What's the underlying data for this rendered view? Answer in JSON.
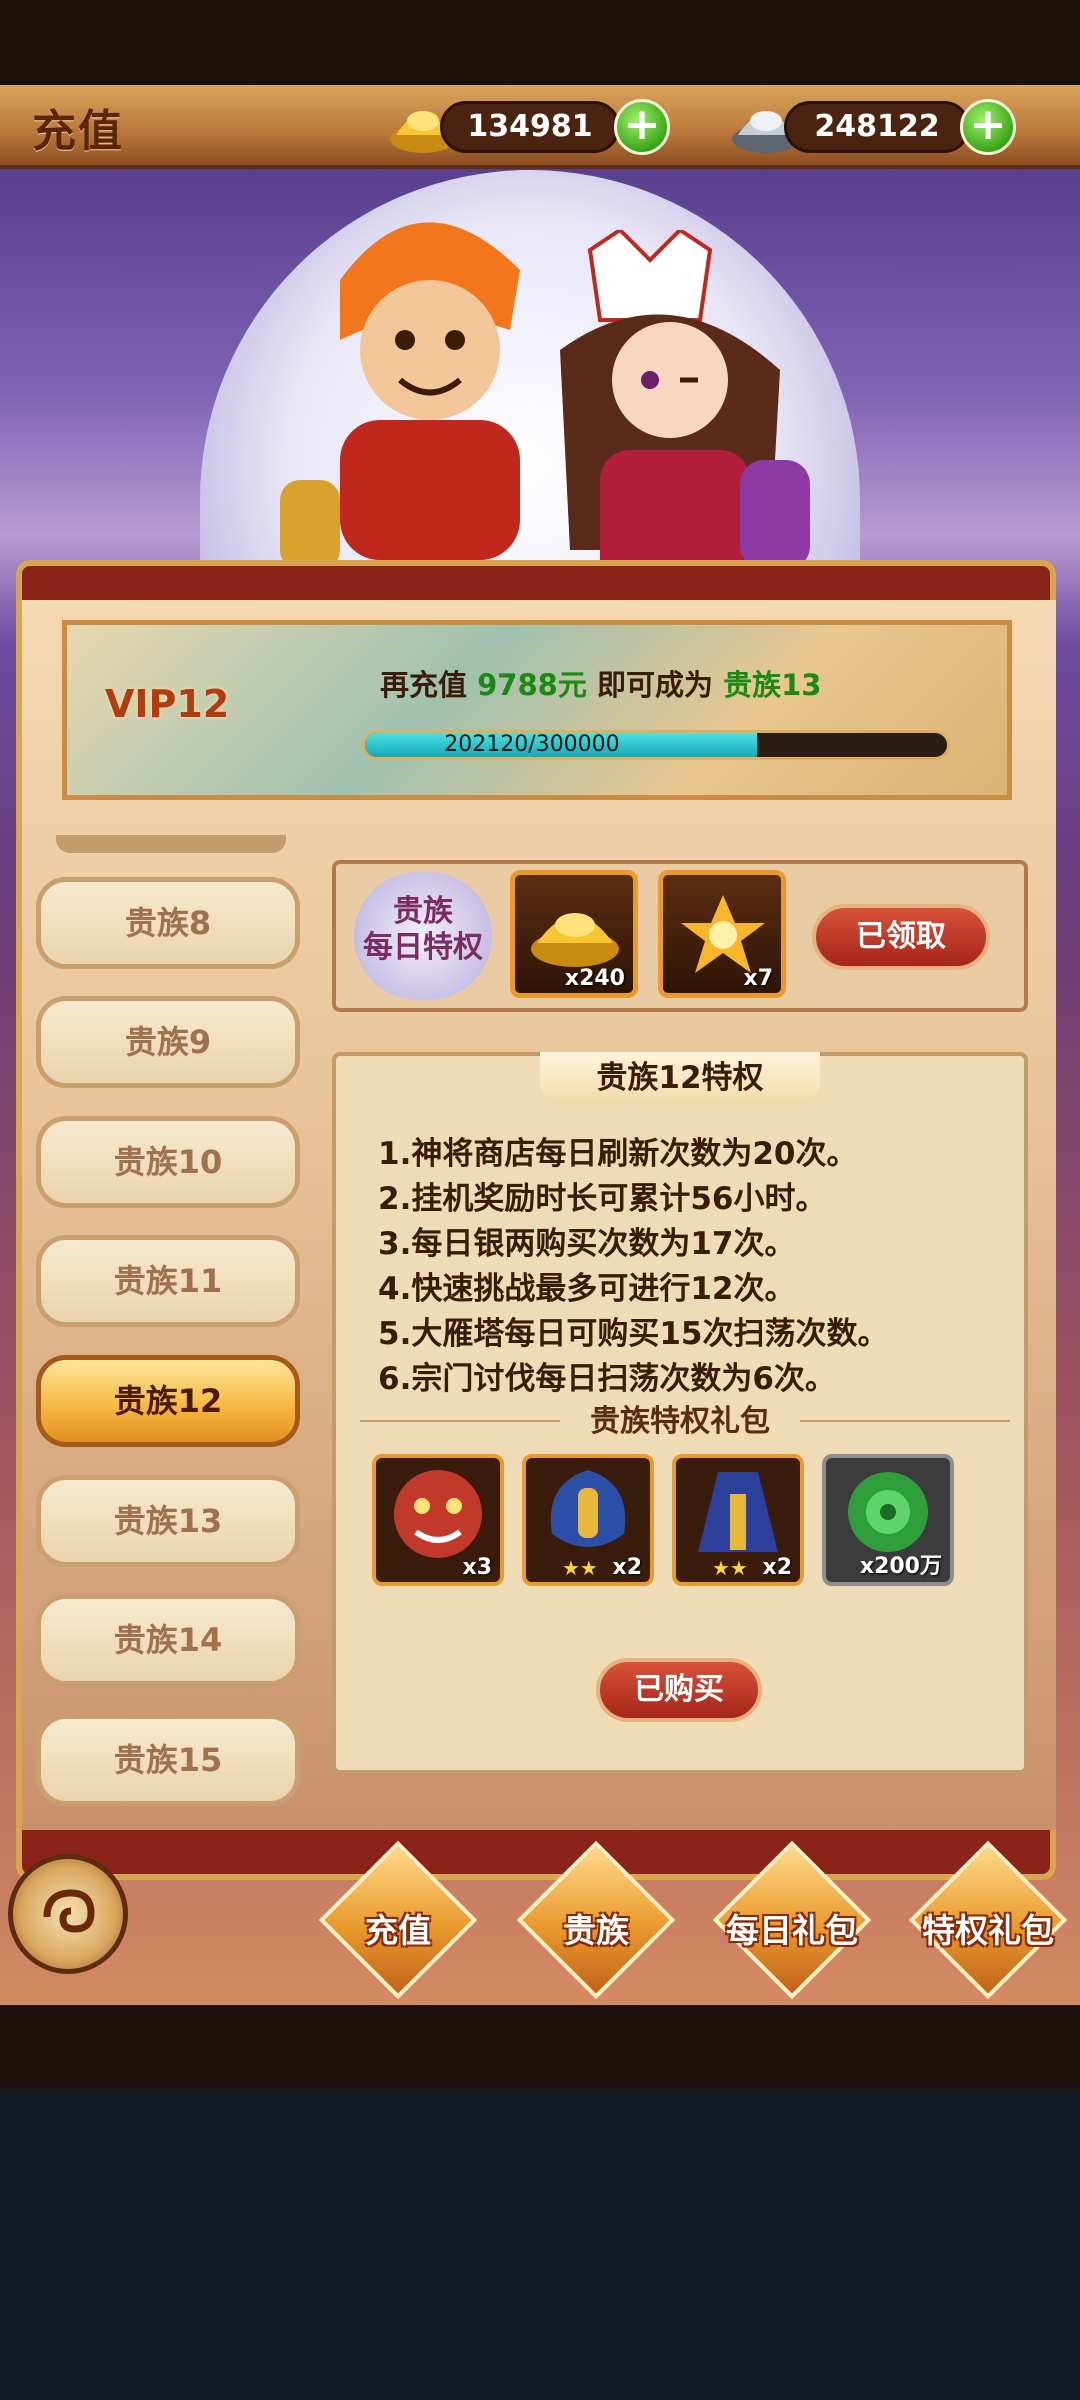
{
  "header": {
    "title": "充值",
    "gold_amount": "134981",
    "silver_amount": "248122"
  },
  "vip": {
    "label": "VIP12",
    "line_prefix": "再充值",
    "amount": "9788元",
    "line_mid": "即可成为",
    "target": "贵族13",
    "progress_text": "202120/300000",
    "progress_fraction": 0.6737
  },
  "tiers": [
    {
      "label": "贵族8"
    },
    {
      "label": "贵族9"
    },
    {
      "label": "贵族10"
    },
    {
      "label": "贵族11"
    },
    {
      "label": "贵族12",
      "selected": true
    },
    {
      "label": "贵族13"
    },
    {
      "label": "贵族14"
    },
    {
      "label": "贵族15"
    }
  ],
  "daily": {
    "badge_line1": "贵族",
    "badge_line2": "每日特权",
    "items": [
      {
        "icon": "gold-ingot-icon",
        "qty": "x240"
      },
      {
        "icon": "golden-scroll-icon",
        "qty": "x7"
      }
    ],
    "button_label": "已领取"
  },
  "privilege": {
    "title": "贵族12特权",
    "lines": [
      "1.神将商店每日刷新次数为20次。",
      "2.挂机奖励时长可累计56小时。",
      "3.每日银两购买次数为17次。",
      "4.快速挑战最多可进行12次。",
      "5.大雁塔每日可购买15次扫荡次数。",
      "6.宗门讨伐每日扫荡次数为6次。"
    ],
    "gift_title": "贵族特权礼包",
    "gifts": [
      {
        "icon": "lion-hero-icon",
        "qty": "x3",
        "color": "#c0392b"
      },
      {
        "icon": "blue-armor-icon",
        "qty": "x2",
        "color": "#2c4fa8"
      },
      {
        "icon": "blue-robe-icon",
        "qty": "x2",
        "color": "#2c3f9a"
      },
      {
        "icon": "jade-orb-icon",
        "qty": "x200万",
        "color": "#2f9e3c"
      }
    ],
    "button_label": "已购买"
  },
  "nav": [
    {
      "label": "充值"
    },
    {
      "label": "贵族"
    },
    {
      "label": "每日礼包"
    },
    {
      "label": "特权礼包"
    }
  ]
}
